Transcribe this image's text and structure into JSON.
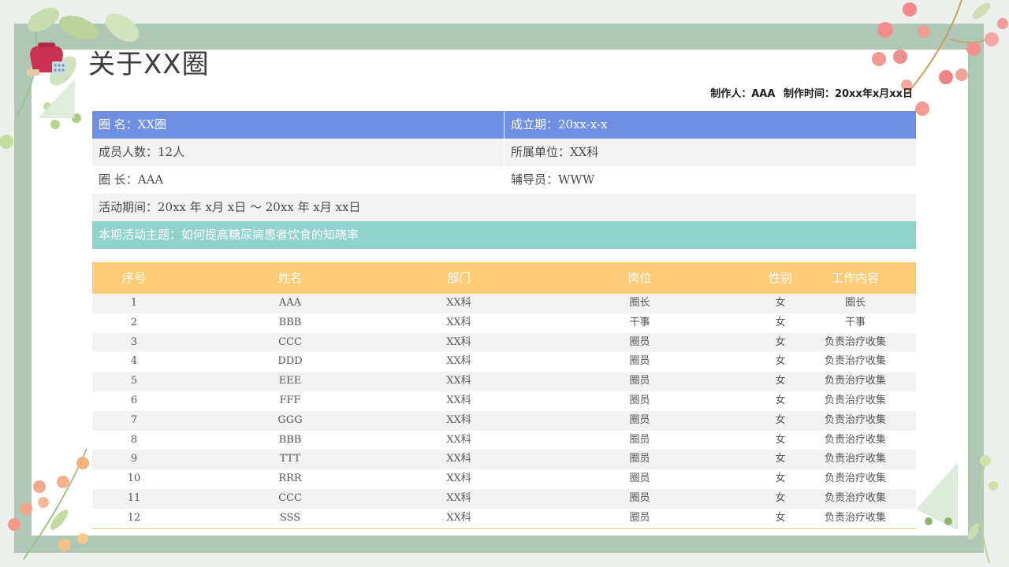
{
  "page": {
    "title": "关于XX圈",
    "credits": {
      "maker": "制作人：AAA",
      "time": "制作时间：20xx年x月xx日"
    }
  },
  "info": {
    "circle_name": "圈  名：XX圈",
    "founded": "成立期：20xx-x-x",
    "member_count": "成员人数：12人",
    "unit": "所属单位：XX科",
    "leader": "圈  长：AAA",
    "advisor": "辅导员：WWW",
    "period": "活动期间：20xx 年  x月  x日  ～    20xx    年 x月 xx日",
    "theme": "本期活动主题：如何提高糖尿病患者饮食的知晓率"
  },
  "members": {
    "headers": [
      "序号",
      "姓名",
      "部门",
      "岗位",
      "性别",
      "工作内容"
    ],
    "rows": [
      [
        "1",
        "AAA",
        "XX科",
        "圈长",
        "女",
        "圈长"
      ],
      [
        "2",
        "BBB",
        "XX科",
        "干事",
        "女",
        "干事"
      ],
      [
        "3",
        "CCC",
        "XX科",
        "圈员",
        "女",
        "负责治疗收集"
      ],
      [
        "4",
        "DDD",
        "XX科",
        "圈员",
        "女",
        "负责治疗收集"
      ],
      [
        "5",
        "EEE",
        "XX科",
        "圈员",
        "女",
        "负责治疗收集"
      ],
      [
        "6",
        "FFF",
        "XX科",
        "圈员",
        "女",
        "负责治疗收集"
      ],
      [
        "7",
        "GGG",
        "XX科",
        "圈员",
        "女",
        "负责治疗收集"
      ],
      [
        "8",
        "BBB",
        "XX科",
        "圈员",
        "女",
        "负责治疗收集"
      ],
      [
        "9",
        "TTT",
        "XX科",
        "圈员",
        "女",
        "负责治疗收集"
      ],
      [
        "10",
        "RRR",
        "XX科",
        "圈员",
        "女",
        "负责治疗收集"
      ],
      [
        "11",
        "CCC",
        "XX科",
        "圈员",
        "女",
        "负责治疗收集"
      ],
      [
        "12",
        "SSS",
        "XX科",
        "圈员",
        "女",
        "负责治疗收集"
      ]
    ]
  },
  "colors": {
    "frame": "#aec7b7",
    "info_header": "#6f8fe2",
    "theme_row": "#8fd3cb",
    "table_header": "#fccb78"
  },
  "icons": [
    "medical-bag-icon",
    "leaf-branch-decoration",
    "berry-branch-decoration"
  ]
}
